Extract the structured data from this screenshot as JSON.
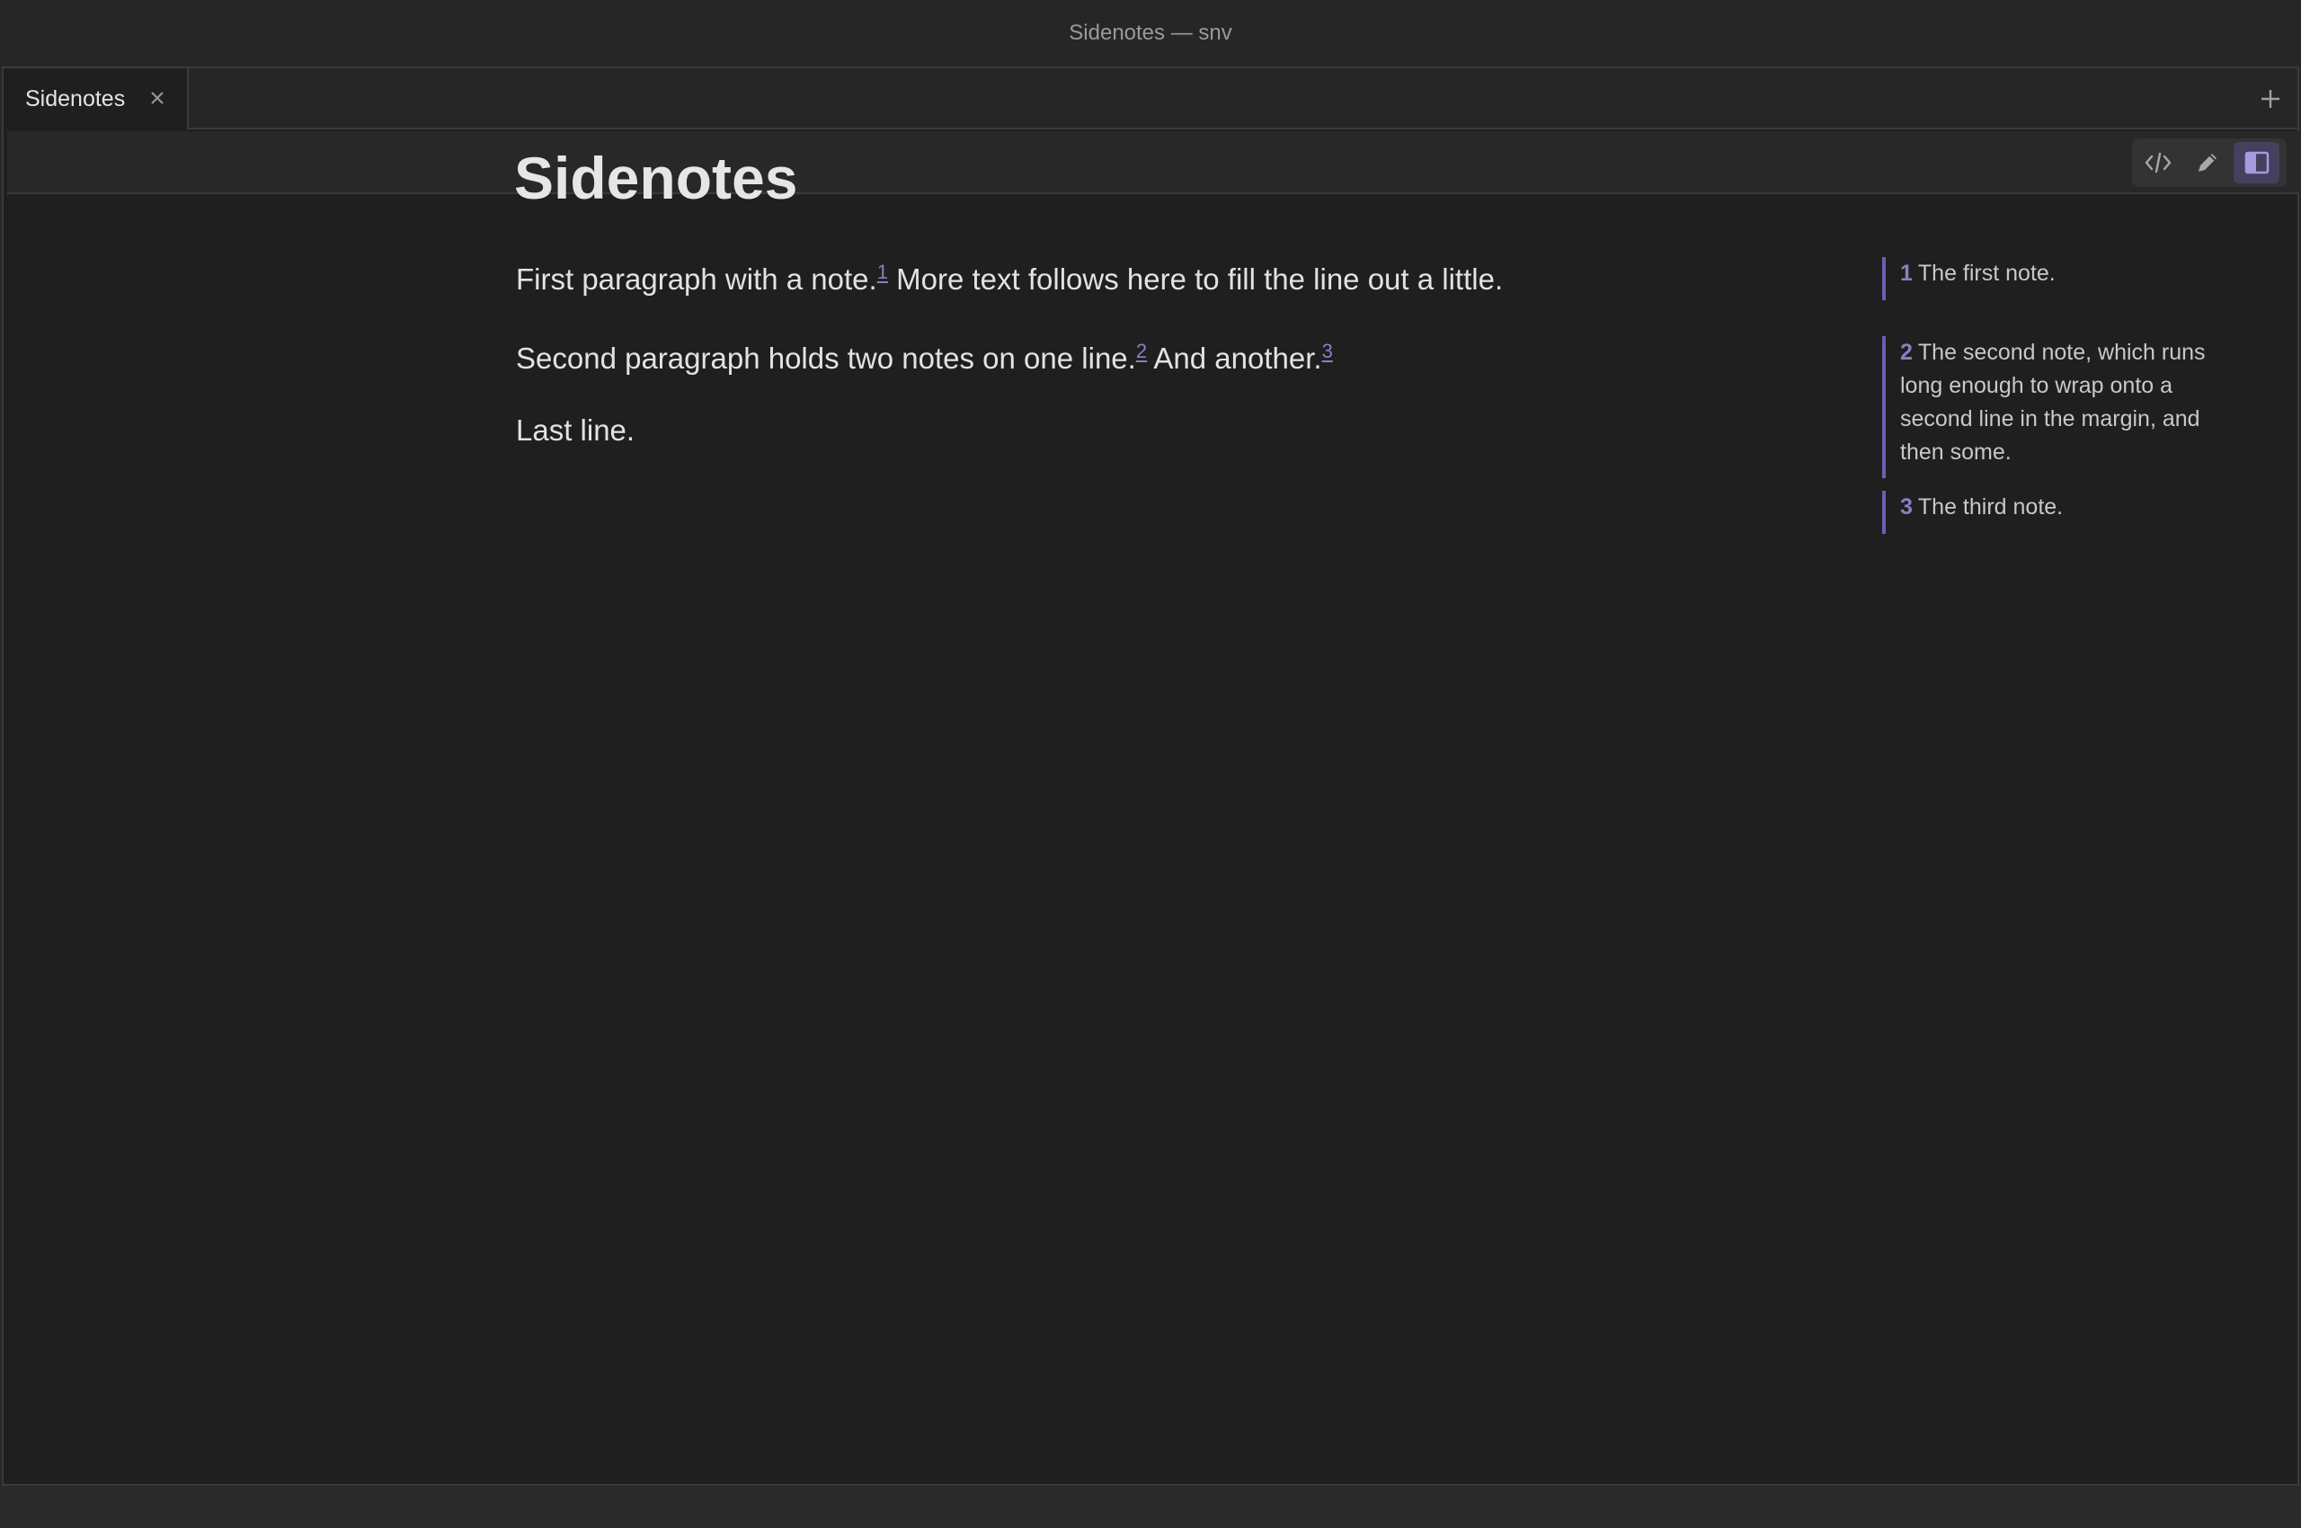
{
  "window": {
    "title": "Sidenotes — snv"
  },
  "tabs": [
    {
      "label": "Sidenotes",
      "close_icon": "close-icon"
    }
  ],
  "new_tab_icon": "plus-icon",
  "toolbar": {
    "modes": [
      {
        "name": "source",
        "icon": "code-icon",
        "active": false
      },
      {
        "name": "edit",
        "icon": "pencil-icon",
        "active": false
      },
      {
        "name": "reading",
        "icon": "book-icon",
        "active": true
      }
    ]
  },
  "document": {
    "title": "Sidenotes",
    "p1": {
      "before": "First paragraph with a note.",
      "ref": "1",
      "after": " More text follows here to fill the line out a little."
    },
    "p2": {
      "before": "Second paragraph holds two notes on one line.",
      "ref1": "2",
      "middle": " And another.",
      "ref2": "3"
    },
    "p3": "Last line."
  },
  "sidenotes": [
    {
      "num": "1",
      "text": "The first note."
    },
    {
      "num": "2",
      "text": "The second note, which runs long enough to wrap onto a second line in the margin, and then some."
    },
    {
      "num": "3",
      "text": "The third note."
    }
  ],
  "colors": {
    "accent": "#8a7fc4",
    "background": "#1f1f1f",
    "text": "#e2e2e2"
  }
}
